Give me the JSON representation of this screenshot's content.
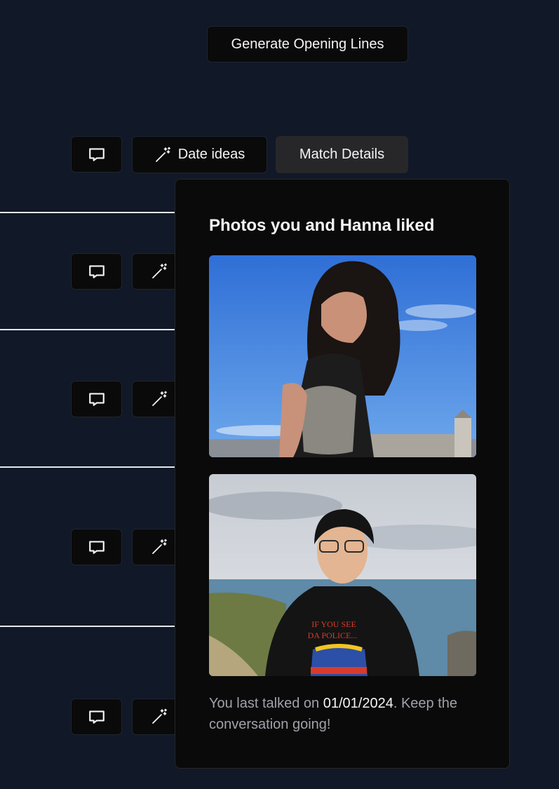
{
  "header": {
    "generate_label": "Generate Opening Lines"
  },
  "toolbar": {
    "date_ideas_label": "Date ideas",
    "match_details_label": "Match Details"
  },
  "popover": {
    "title": "Photos you and Hanna liked",
    "caption_prefix": "You last talked on ",
    "last_talked_date": "01/01/2024",
    "caption_suffix": ". Keep the conversation going!"
  },
  "photo_2_shirt_text": [
    "IF YOU SEE",
    "DA POLICE..."
  ],
  "icons": [
    "message-square-icon",
    "wand-sparkles-icon"
  ],
  "colors": {
    "background": "#111827",
    "button_bg": "#0a0a0a",
    "active_button_bg": "#27272a",
    "popover_bg": "#0a0a0a",
    "muted_text": "#a1a1aa"
  }
}
